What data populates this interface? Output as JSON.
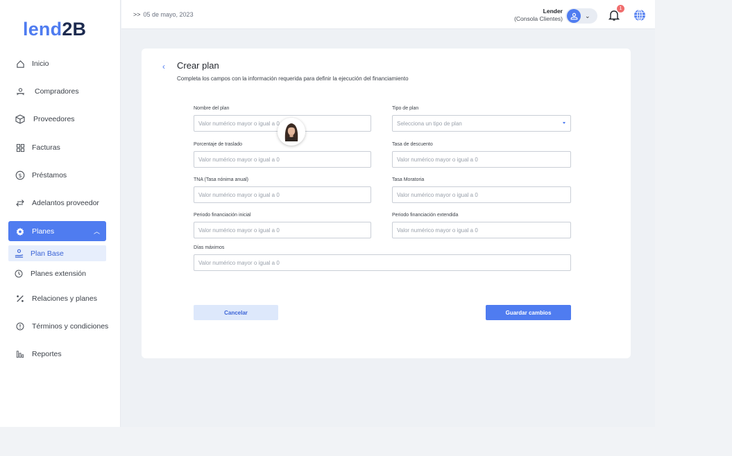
{
  "brand": {
    "part1": "lend",
    "part2": "2B"
  },
  "header": {
    "date": "05 de mayo, 2023",
    "user_name": "Lender",
    "user_role": "(Consola Clientes)",
    "notification_count": "1"
  },
  "sidebar": {
    "items": [
      {
        "label": "Inicio",
        "icon": "home-icon"
      },
      {
        "label": "Compradores",
        "icon": "users-icon"
      },
      {
        "label": "Proveedores",
        "icon": "box-icon"
      },
      {
        "label": "Facturas",
        "icon": "grid-icon"
      },
      {
        "label": "Préstamos",
        "icon": "dollar-icon"
      },
      {
        "label": "Adelantos proveedor",
        "icon": "swap-icon"
      },
      {
        "label": "Planes",
        "icon": "gear-icon"
      },
      {
        "label": "Plan Base",
        "icon": "user-hand-icon"
      },
      {
        "label": "Planes extensión",
        "icon": "clock-icon"
      },
      {
        "label": "Relaciones y planes",
        "icon": "percent-icon"
      },
      {
        "label": "Términos y condiciones",
        "icon": "info-icon"
      },
      {
        "label": "Reportes",
        "icon": "chart-icon"
      }
    ]
  },
  "form": {
    "title": "Crear plan",
    "subtitle": "Completa los campos con la información requerida para definir la ejecución del financiamiento",
    "fields": [
      {
        "label": "Nombre del plan",
        "placeholder": "Valor numérico mayor o igual a 0"
      },
      {
        "label": "Tipo de plan",
        "placeholder": "Selecciona un tipo de plan"
      },
      {
        "label": "Porcentaje de traslado",
        "placeholder": "Valor numérico mayor o igual a 0"
      },
      {
        "label": "Tasa de descuento",
        "placeholder": "Valor numérico mayor o igual a 0"
      },
      {
        "label": "TNA (Tasa nónima anual)",
        "placeholder": "Valor numérico mayor o igual a 0"
      },
      {
        "label": "Tasa Moratoria",
        "placeholder": "Valor numérico mayor o igual a 0"
      },
      {
        "label": "Periodo financiación inicial",
        "placeholder": "Valor numérico mayor o igual a 0"
      },
      {
        "label": "Periodo financiación extendida",
        "placeholder": "Valor numérico mayor o igual a 0"
      },
      {
        "label": "Días máximos",
        "placeholder": "Valor numérico mayor o igual a 0"
      }
    ],
    "cancel_label": "Cancelar",
    "save_label": "Guardar cambios"
  },
  "colors": {
    "accent": "#4f7cf0",
    "brand_dark": "#1c2a4f",
    "badge": "#f06d6d"
  }
}
